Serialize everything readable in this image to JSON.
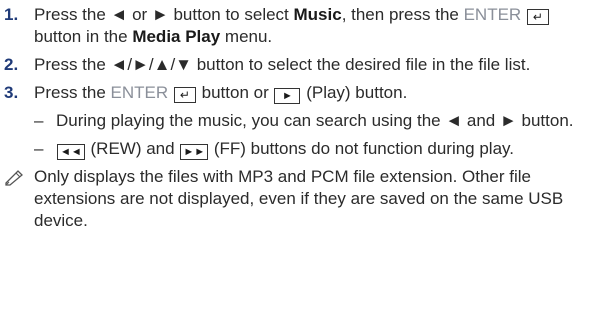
{
  "steps": [
    {
      "number": "1.",
      "t1": "Press the ◄ or ► button to select ",
      "b1": "Music",
      "t2": ", then press the ",
      "enter": "ENTER",
      "t3": " button in the ",
      "b2": "Media Play",
      "t4": " menu."
    },
    {
      "number": "2.",
      "text": "Press the ◄/►/▲/▼ button to select the desired file in the file list."
    },
    {
      "number": "3.",
      "t1": "Press the ",
      "enter": "ENTER",
      "t2": " button or ",
      "t3": " (Play) button."
    }
  ],
  "subitems": [
    {
      "dash": "–",
      "text": "During playing the music, you can search using the ◄ and ► button."
    },
    {
      "dash": "–",
      "t1": " (REW) and ",
      "t2": " (FF) buttons do not function during play."
    }
  ],
  "note": {
    "icon": "note-pencil-icon",
    "text": "Only displays the files with MP3 and PCM file extension. Other file extensions are not displayed, even if they are saved on the same USB device."
  },
  "icons": {
    "enter_glyph": "↵",
    "play_glyph": "►",
    "rew_glyph": "◄◄",
    "ff_glyph": "►►"
  },
  "colors": {
    "step_number": "#1f3a78",
    "enter_label": "#8a8f99",
    "text": "#2b2b2b"
  }
}
